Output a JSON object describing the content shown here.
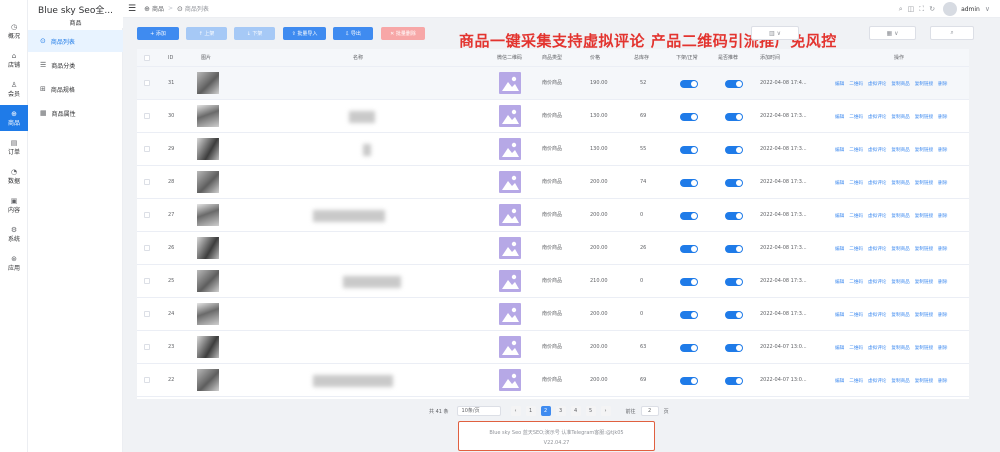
{
  "brand": {
    "title": "Blue sky Seo全...",
    "subtitle": "商品"
  },
  "rail": [
    {
      "icon": "dashboard-icon",
      "glyph": "◷",
      "label": "概况"
    },
    {
      "icon": "store-icon",
      "glyph": "⌂",
      "label": "店铺"
    },
    {
      "icon": "user-icon",
      "glyph": "♙",
      "label": "会员"
    },
    {
      "icon": "goods-icon",
      "glyph": "⊕",
      "label": "商品",
      "active": true
    },
    {
      "icon": "order-icon",
      "glyph": "▤",
      "label": "订单"
    },
    {
      "icon": "data-icon",
      "glyph": "◔",
      "label": "数据"
    },
    {
      "icon": "content-icon",
      "glyph": "▣",
      "label": "内容"
    },
    {
      "icon": "system-icon",
      "glyph": "⚙",
      "label": "系统"
    },
    {
      "icon": "app-icon",
      "glyph": "⊛",
      "label": "应用"
    }
  ],
  "subnav": [
    {
      "icon": "list-icon",
      "glyph": "⊙",
      "label": "商品列表",
      "active": true
    },
    {
      "icon": "category-icon",
      "glyph": "☰",
      "label": "商品分类"
    },
    {
      "icon": "spec-icon",
      "glyph": "⊞",
      "label": "商品规格"
    },
    {
      "icon": "attribute-icon",
      "glyph": "▦",
      "label": "商品属性"
    }
  ],
  "breadcrumb": {
    "root": "商品",
    "current": "商品列表"
  },
  "header": {
    "user": "admin",
    "caret": "∨"
  },
  "toolbar": {
    "add": "+ 添加",
    "up": "↑ 上架",
    "down": "↓ 下架",
    "import": "⇪ 批量导入",
    "export": "⇩ 导出",
    "batch_delete": "✕ 批量删除"
  },
  "banner": "商品一键采集支持虚拟评论 产品二维码引流推广免风控",
  "columns": {
    "id": "ID",
    "image": "图片",
    "name": "名称",
    "qrcode": "微信二维码",
    "type": "商品类型",
    "price": "价格",
    "stock": "总库存",
    "status": "下架/正常",
    "recommend": "是否推荐",
    "created": "添加时间",
    "actions": "操作"
  },
  "actions": [
    "编辑",
    "二维码",
    "虚拟评论",
    "复制商品",
    "复制链接",
    "删除"
  ],
  "rows": [
    {
      "id": "31",
      "type": "南价商品",
      "price": "190.00",
      "stock": "52",
      "created": "2022-04-08 17:4..."
    },
    {
      "id": "30",
      "type": "南价商品",
      "price": "130.00",
      "stock": "69",
      "created": "2022-04-08 17:3..."
    },
    {
      "id": "29",
      "type": "南价商品",
      "price": "130.00",
      "stock": "55",
      "created": "2022-04-08 17:3..."
    },
    {
      "id": "28",
      "type": "南价商品",
      "price": "200.00",
      "stock": "74",
      "created": "2022-04-08 17:3..."
    },
    {
      "id": "27",
      "type": "南价商品",
      "price": "200.00",
      "stock": "0",
      "created": "2022-04-08 17:3..."
    },
    {
      "id": "26",
      "type": "南价商品",
      "price": "200.00",
      "stock": "26",
      "created": "2022-04-08 17:3..."
    },
    {
      "id": "25",
      "type": "南价商品",
      "price": "210.00",
      "stock": "0",
      "created": "2022-04-08 17:3..."
    },
    {
      "id": "24",
      "type": "南价商品",
      "price": "200.00",
      "stock": "0",
      "created": "2022-04-08 17:3..."
    },
    {
      "id": "23",
      "type": "南价商品",
      "price": "200.00",
      "stock": "63",
      "created": "2022-04-07 13:0..."
    },
    {
      "id": "22",
      "type": "南价商品",
      "price": "200.00",
      "stock": "69",
      "created": "2022-04-07 13:0..."
    }
  ],
  "pagination": {
    "total": "共 41 条",
    "page_size": "10条/页",
    "prev": "‹",
    "next": "›",
    "pages": [
      "1",
      "2",
      "3",
      "4",
      "5"
    ],
    "current": "2",
    "goto_label": "前往",
    "goto_value": "2",
    "goto_suffix": "页"
  },
  "footer": {
    "line1": "Blue sky Seo 蓝天SEO;演示号 认准Telegram客服:@tjk05",
    "line2": "V22.04.27"
  },
  "colors": {
    "accent": "#1f7be8",
    "banner": "#e3342f",
    "qr": "#b6a8e6"
  }
}
